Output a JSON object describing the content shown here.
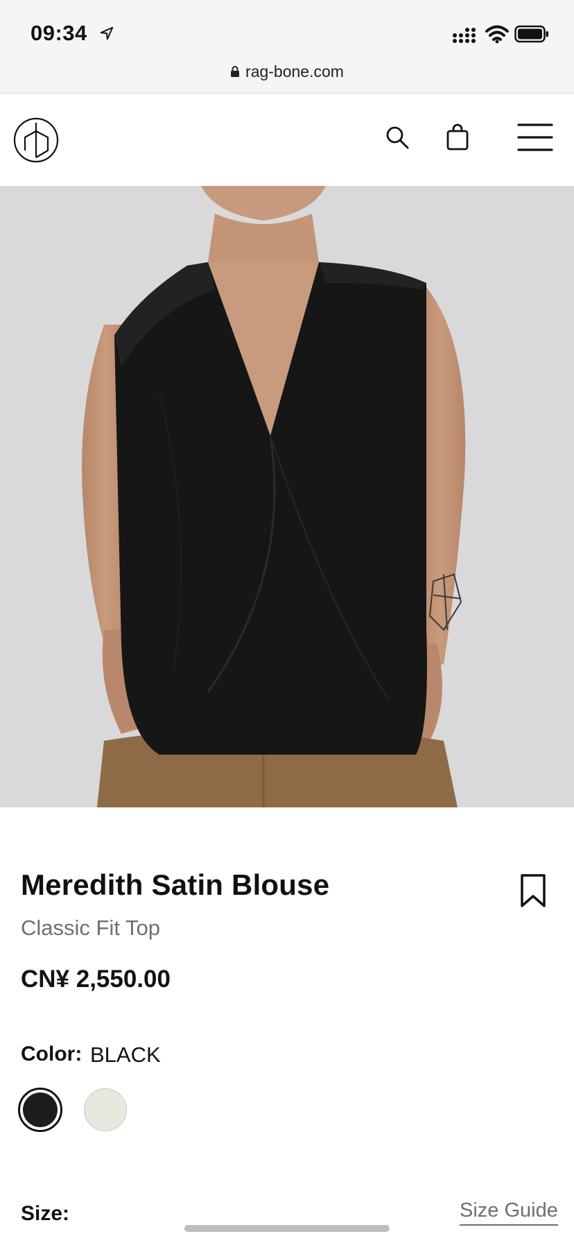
{
  "status_bar": {
    "time": "09:34",
    "icons": [
      "location-arrow-icon",
      "cellular-signal-icon",
      "wifi-icon",
      "battery-icon"
    ]
  },
  "browser": {
    "url": "rag-bone.com",
    "lock_icon": "lock-icon"
  },
  "header": {
    "logo_icon": "rag-bone-logo",
    "icons": [
      "search-icon",
      "shopping-bag-icon",
      "hamburger-menu-icon"
    ]
  },
  "product": {
    "image": "product-photo-black-sleeveless-blouse",
    "title": "Meredith Satin Blouse",
    "subtitle": "Classic Fit Top",
    "price": "CN¥ 2,550.00",
    "bookmark_icon": "bookmark-icon"
  },
  "color": {
    "label": "Color:",
    "value": "BLACK",
    "swatches": [
      {
        "color": "#1c1c1c",
        "selected": true
      },
      {
        "color": "#e9e8e0",
        "selected": false
      }
    ]
  },
  "size": {
    "label": "Size:",
    "guide_link": "Size Guide"
  },
  "colors": {
    "text": "#111111",
    "muted": "#6e6e6e",
    "image_bg": "#d8d8da"
  }
}
